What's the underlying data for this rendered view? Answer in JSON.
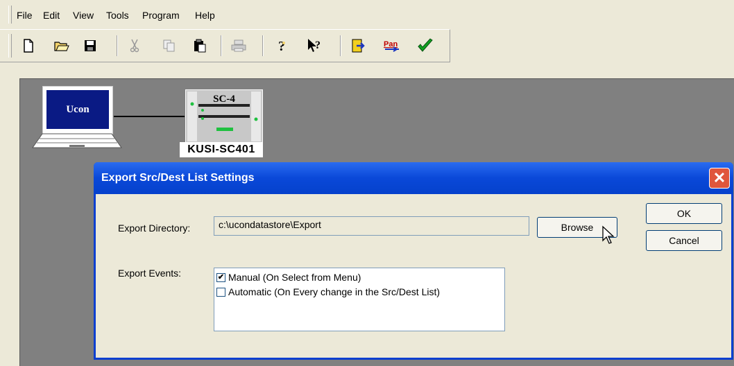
{
  "menu": [
    "File",
    "Edit",
    "View",
    "Tools",
    "Program",
    "Help"
  ],
  "toolbar_icons": [
    "new-icon",
    "open-icon",
    "save-icon",
    "cut-icon",
    "copy-icon",
    "paste-icon",
    "print-icon",
    "help-icon",
    "context-help-icon",
    "program-icon",
    "pan-icon",
    "check-icon"
  ],
  "toolbar_pan_text": "Pan",
  "diagram": {
    "laptop_label": "Ucon",
    "device_model": "SC-4",
    "device_name": "KUSI-SC401"
  },
  "dialog": {
    "title": "Export Src/Dest List Settings",
    "close_glyph": "✕",
    "export_directory_label": "Export Directory:",
    "export_directory_value": "c:\\ucondatastore\\Export",
    "browse_label": "Browse",
    "ok_label": "OK",
    "cancel_label": "Cancel",
    "export_events_label": "Export Events:",
    "events": [
      {
        "label": "Manual (On Select from Menu)",
        "checked": true
      },
      {
        "label": "Automatic (On Every change in the Src/Dest List)",
        "checked": false
      }
    ]
  },
  "colors": {
    "titlebar": "#0a48d8",
    "canvas": "#808080",
    "laptop_screen": "#0a1a84",
    "close": "#e0563c"
  }
}
